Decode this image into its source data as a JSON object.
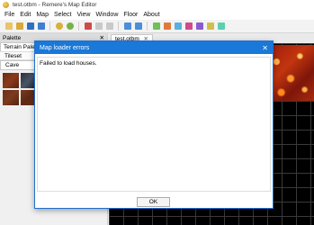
{
  "window": {
    "title": "test.otbm - Remere's Map Editor"
  },
  "menu": [
    "File",
    "Edit",
    "Map",
    "Select",
    "View",
    "Window",
    "Floor",
    "About"
  ],
  "toolbar": {
    "icons": [
      {
        "name": "new-icon",
        "color": "#e9c46a"
      },
      {
        "name": "open-icon",
        "color": "#d9a93a"
      },
      {
        "name": "save-icon",
        "color": "#2f6fc0"
      },
      {
        "name": "save-as-icon",
        "color": "#3d7fd0"
      },
      {
        "name": "undo-icon",
        "color": "#d8b13a"
      },
      {
        "name": "redo-icon",
        "color": "#78b24a"
      },
      {
        "name": "cut-icon",
        "color": "#d04a4a"
      },
      {
        "name": "copy-icon",
        "color": "#c9c9c9"
      },
      {
        "name": "paste-icon",
        "color": "#c9c9c9"
      },
      {
        "name": "brush-icon",
        "color": "#4a8fd8"
      },
      {
        "name": "zoom-icon",
        "color": "#4a8fd8"
      },
      {
        "name": "flag-1-icon",
        "color": "#6fbf5a"
      },
      {
        "name": "flag-2-icon",
        "color": "#e07a3a"
      },
      {
        "name": "flag-3-icon",
        "color": "#5aaee0"
      },
      {
        "name": "flag-4-icon",
        "color": "#d04a8a"
      },
      {
        "name": "flag-5-icon",
        "color": "#8a5ad0"
      },
      {
        "name": "flag-6-icon",
        "color": "#d0c04a"
      },
      {
        "name": "flag-7-icon",
        "color": "#5ad0b0"
      }
    ]
  },
  "palette": {
    "title": "Palette",
    "close": "✕",
    "tab": "Terrain Palette",
    "tileset_label": "Tileset",
    "tileset_value": "Cave"
  },
  "document": {
    "tab": "test.otbm",
    "close": "✕"
  },
  "dialog": {
    "title": "Map loader errors",
    "close": "✕",
    "message": "Failed to load houses.",
    "ok_label": "OK"
  }
}
